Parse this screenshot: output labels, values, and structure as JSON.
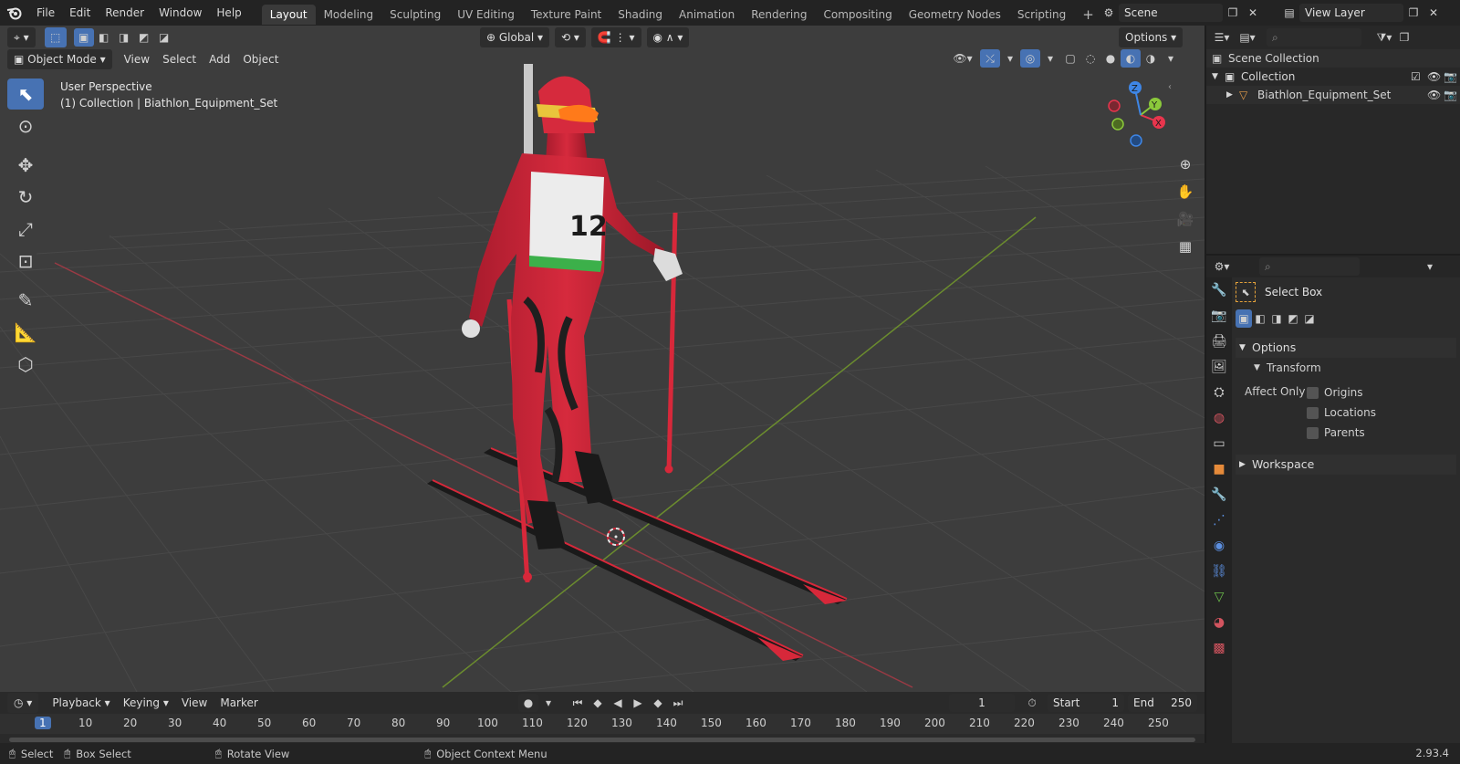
{
  "menubar": {
    "items": [
      "File",
      "Edit",
      "Render",
      "Window",
      "Help"
    ],
    "workspaces": [
      "Layout",
      "Modeling",
      "Sculpting",
      "UV Editing",
      "Texture Paint",
      "Shading",
      "Animation",
      "Rendering",
      "Compositing",
      "Geometry Nodes",
      "Scripting"
    ],
    "active_workspace": "Layout",
    "add_tab": "+",
    "scene": "Scene",
    "view_layer": "View Layer"
  },
  "viewport": {
    "transform_orientation": "Global",
    "options": "Options",
    "mode": "Object Mode",
    "menus": [
      "View",
      "Select",
      "Add",
      "Object"
    ],
    "perspective": "User Perspective",
    "collection_info": "(1) Collection | Biathlon_Equipment_Set",
    "bib_number": "12",
    "gizmo_axes": [
      "X",
      "Y",
      "Z"
    ]
  },
  "timeline": {
    "menus": [
      "Playback",
      "Keying",
      "View",
      "Marker"
    ],
    "current_frame": "1",
    "start_label": "Start",
    "start": "1",
    "end_label": "End",
    "end": "250",
    "ticks": [
      "1",
      "10",
      "20",
      "30",
      "40",
      "50",
      "60",
      "70",
      "80",
      "90",
      "100",
      "110",
      "120",
      "130",
      "140",
      "150",
      "160",
      "170",
      "180",
      "190",
      "200",
      "210",
      "220",
      "230",
      "240",
      "250"
    ]
  },
  "statusbar": {
    "select": "Select",
    "box_select": "Box Select",
    "rotate_view": "Rotate View",
    "context_menu": "Object Context Menu",
    "version": "2.93.4"
  },
  "outliner": {
    "scene_collection": "Scene Collection",
    "collection": "Collection",
    "object": "Biathlon_Equipment_Set"
  },
  "properties": {
    "tool_name": "Select Box",
    "options": "Options",
    "transform": "Transform",
    "affect_only": "Affect Only",
    "origins": "Origins",
    "locations": "Locations",
    "parents": "Parents",
    "workspace": "Workspace"
  },
  "colors": {
    "accent": "#4772b3",
    "x_axis": "#e8354d",
    "y_axis": "#8bc93b",
    "z_axis": "#3e86e6",
    "suit": "#c92437"
  }
}
